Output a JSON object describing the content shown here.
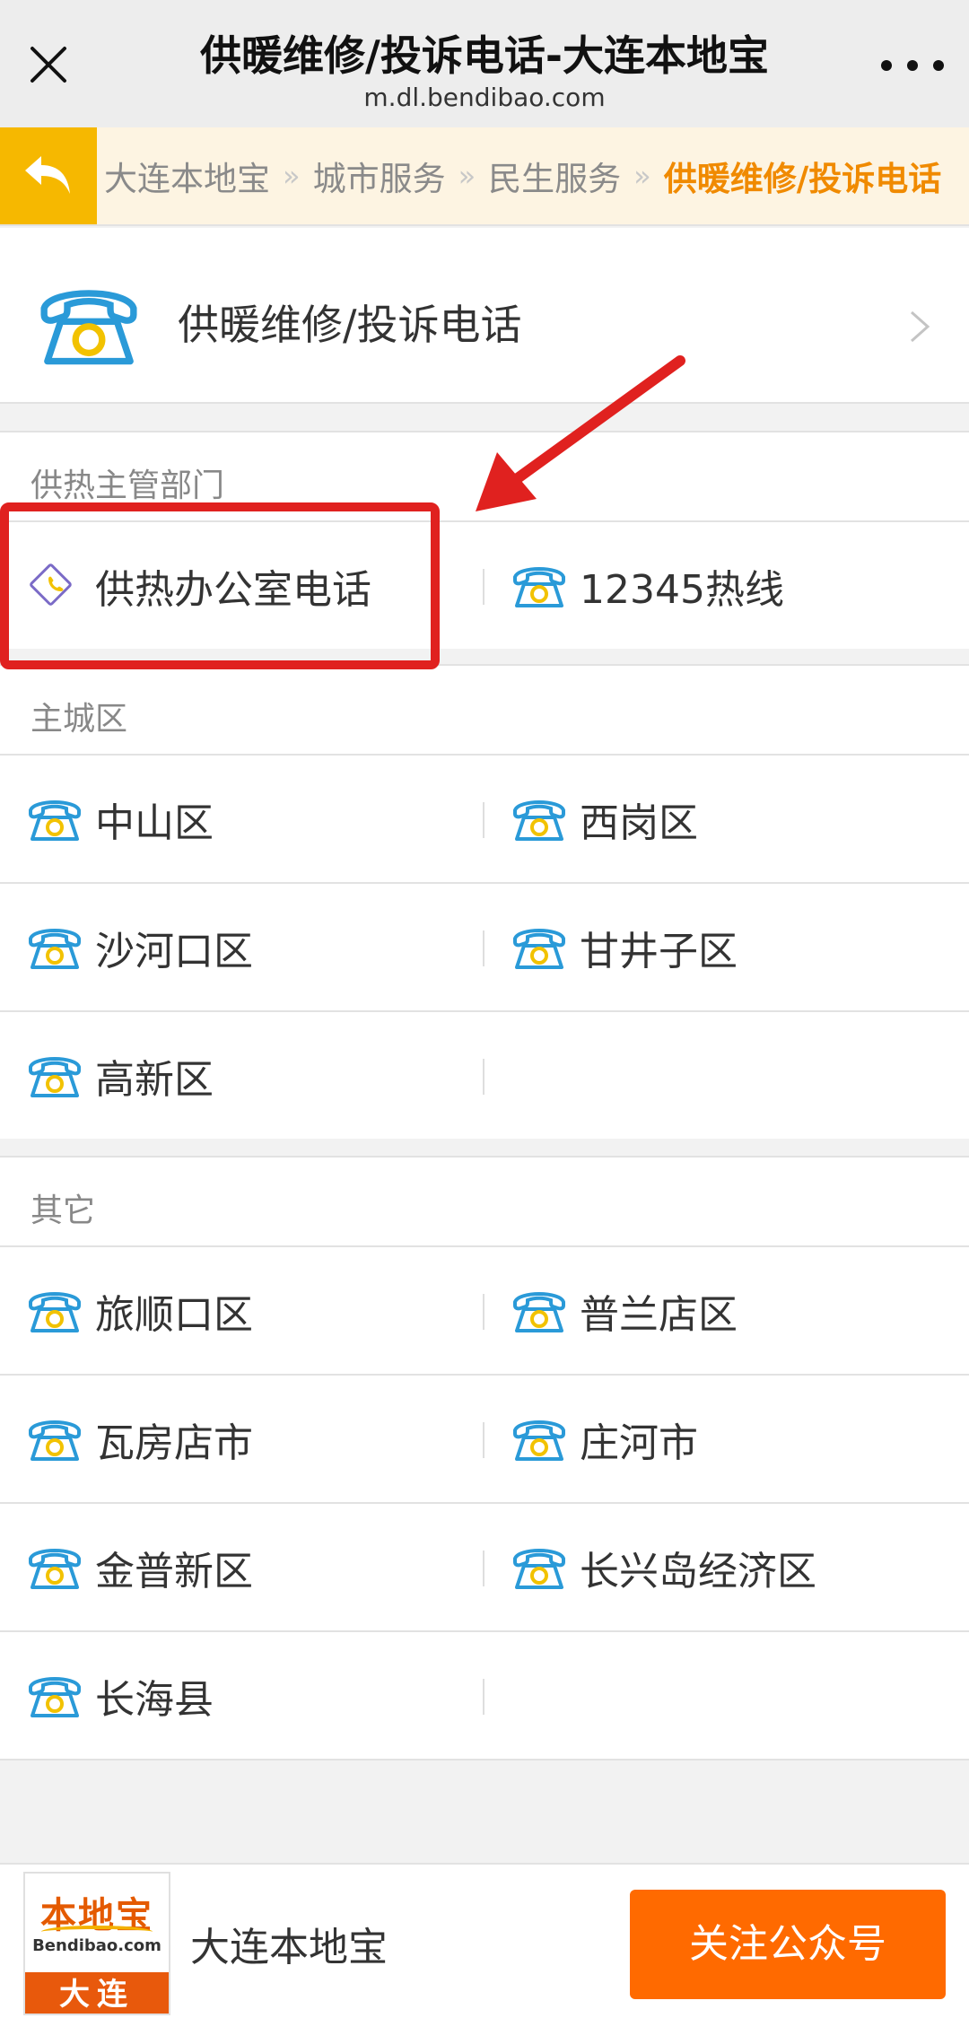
{
  "topbar": {
    "title": "供暖维修/投诉电话-大连本地宝",
    "url": "m.dl.bendibao.com"
  },
  "breadcrumb": {
    "items": [
      "大连本地宝",
      "城市服务",
      "民生服务",
      "供暖维修/投诉电话"
    ],
    "separator": "»"
  },
  "header": {
    "title": "供暖维修/投诉电话"
  },
  "sections": {
    "s1": {
      "title": "供热主管部门",
      "items": [
        "供热办公室电话",
        "12345热线"
      ]
    },
    "s2": {
      "title": "主城区",
      "items": [
        "中山区",
        "西岗区",
        "沙河口区",
        "甘井子区",
        "高新区"
      ]
    },
    "s3": {
      "title": "其它",
      "items": [
        "旅顺口区",
        "普兰店区",
        "瓦房店市",
        "庄河市",
        "金普新区",
        "长兴岛经济区",
        "长海县"
      ]
    }
  },
  "footer": {
    "logo_main": "本地宝",
    "logo_sub": "Bendibao.com",
    "logo_city": "大连",
    "name": "大连本地宝",
    "follow_label": "关注公众号"
  },
  "colors": {
    "accent_orange": "#f08a00",
    "back_button": "#f6b800",
    "follow_button": "#ff6a00",
    "highlight_red": "#e0211f",
    "phone_icon_blue": "#2a9ad8",
    "phone_icon_yellow": "#f2c200"
  },
  "icons": {
    "close": "close-icon",
    "more": "more-icon",
    "back": "back-arrow-icon",
    "phone": "telephone-icon",
    "office_phone": "diamond-phone-icon",
    "chevron": "chevron-right-icon"
  }
}
